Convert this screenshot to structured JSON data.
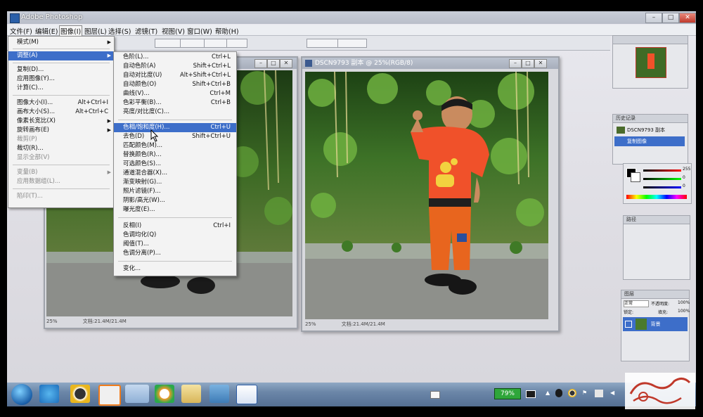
{
  "app": {
    "title": "Adobe Photoshop",
    "window_buttons": [
      "–",
      "□",
      "✕"
    ]
  },
  "menubar": [
    "文件(F)",
    "编辑(E)",
    "图像(I)",
    "图层(L)",
    "选择(S)",
    "滤镜(T)",
    "视图(V)",
    "窗口(W)",
    "帮助(H)"
  ],
  "image_menu": [
    {
      "label": "模式(M)",
      "submenu": true
    },
    {
      "separator": true
    },
    {
      "label": "调整(A)",
      "submenu": true,
      "highlighted": true
    },
    {
      "separator": true
    },
    {
      "label": "复制(D)..."
    },
    {
      "label": "应用图像(Y)..."
    },
    {
      "label": "计算(C)..."
    },
    {
      "separator": true
    },
    {
      "label": "图像大小(I)...",
      "shortcut": "Alt+Ctrl+I"
    },
    {
      "label": "画布大小(S)...",
      "shortcut": "Alt+Ctrl+C"
    },
    {
      "label": "像素长宽比(X)",
      "submenu": true
    },
    {
      "label": "旋转画布(E)",
      "submenu": true
    },
    {
      "label": "裁剪(P)",
      "disabled": true
    },
    {
      "label": "裁切(R)..."
    },
    {
      "label": "显示全部(V)",
      "disabled": true
    },
    {
      "separator": true
    },
    {
      "label": "变量(B)",
      "submenu": true,
      "disabled": true
    },
    {
      "label": "应用数据组(L)...",
      "disabled": true
    },
    {
      "separator": true
    },
    {
      "label": "陷印(T)...",
      "disabled": true
    }
  ],
  "adjust_menu": [
    {
      "label": "色阶(L)...",
      "shortcut": "Ctrl+L"
    },
    {
      "label": "自动色阶(A)",
      "shortcut": "Shift+Ctrl+L"
    },
    {
      "label": "自动对比度(U)",
      "shortcut": "Alt+Shift+Ctrl+L"
    },
    {
      "label": "自动颜色(O)",
      "shortcut": "Shift+Ctrl+B"
    },
    {
      "label": "曲线(V)...",
      "shortcut": "Ctrl+M"
    },
    {
      "label": "色彩平衡(B)...",
      "shortcut": "Ctrl+B"
    },
    {
      "label": "亮度/对比度(C)..."
    },
    {
      "separator": true
    },
    {
      "label": "色相/饱和度(H)...",
      "shortcut": "Ctrl+U",
      "highlighted": true
    },
    {
      "label": "去色(D)",
      "shortcut": "Shift+Ctrl+U"
    },
    {
      "label": "匹配颜色(M)..."
    },
    {
      "label": "替换颜色(R)..."
    },
    {
      "label": "可选颜色(S)..."
    },
    {
      "label": "通道混合器(X)..."
    },
    {
      "label": "渐变映射(G)..."
    },
    {
      "label": "照片滤镜(F)..."
    },
    {
      "label": "阴影/高光(W)..."
    },
    {
      "label": "曝光度(E)..."
    },
    {
      "separator": true
    },
    {
      "label": "反相(I)",
      "shortcut": "Ctrl+I"
    },
    {
      "label": "色调均化(Q)"
    },
    {
      "label": "阈值(T)..."
    },
    {
      "label": "色调分离(P)..."
    },
    {
      "separator": true
    },
    {
      "label": "变化..."
    }
  ],
  "doc_left": {
    "status_zoom": "25%",
    "status_doc": "文档:21.4M/21.4M"
  },
  "doc_right": {
    "title": "DSCN9793 副本 @ 25%(RGB/8)",
    "status_zoom": "25%",
    "status_doc": "文档:21.4M/21.4M"
  },
  "panels": {
    "history_title": "历史记录",
    "history_items": [
      "DSCN9793 副本",
      "复制图像"
    ],
    "color_values": [
      "255",
      "0",
      "0"
    ],
    "paths_title": "路径",
    "layers_title": "图层",
    "layers_mode": "正常",
    "layers_opacity_label": "不透明度:",
    "layers_opacity_value": "100%",
    "layers_lock_label": "锁定:",
    "layers_fill_label": "填充:",
    "layers_fill_value": "100%",
    "layer_name": "背景"
  },
  "taskbar": {
    "battery": "79%"
  },
  "colors": {
    "highlight": "#3d6ec9",
    "shirt": "#f0512a",
    "pants": "#e8651e",
    "taskbar": "#6b86a8"
  }
}
